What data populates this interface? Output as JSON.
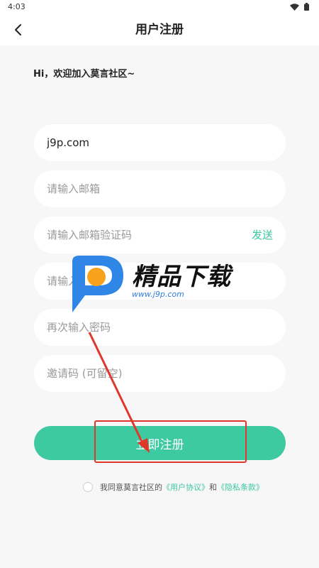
{
  "status_bar": {
    "time": "4:03"
  },
  "header": {
    "title": "用户注册",
    "back_icon": "chevron-left-icon"
  },
  "greeting": "Hi，欢迎加入莫言社区~",
  "form": {
    "username": {
      "value": "j9p.com"
    },
    "email": {
      "placeholder": "请输入邮箱"
    },
    "email_code": {
      "placeholder": "请输入邮箱验证码",
      "send_label": "发送"
    },
    "password": {
      "placeholder": "请输入密码"
    },
    "password_confirm": {
      "placeholder": "再次输入密码"
    },
    "invite_code": {
      "placeholder": "邀请码 (可留空)"
    }
  },
  "register_button": {
    "label": "立即注册"
  },
  "agreement": {
    "prefix": "我同意莫言社区的",
    "terms_link": "《用户协议》",
    "conjunction": "和",
    "privacy_link": "《隐私条款》"
  },
  "watermark": {
    "title": "精品下载",
    "url": "www.j9p.com"
  },
  "colors": {
    "accent": "#3dcaa1",
    "link": "#3cc79f",
    "background": "#f7f7f7",
    "annotation": "#e0372b"
  }
}
